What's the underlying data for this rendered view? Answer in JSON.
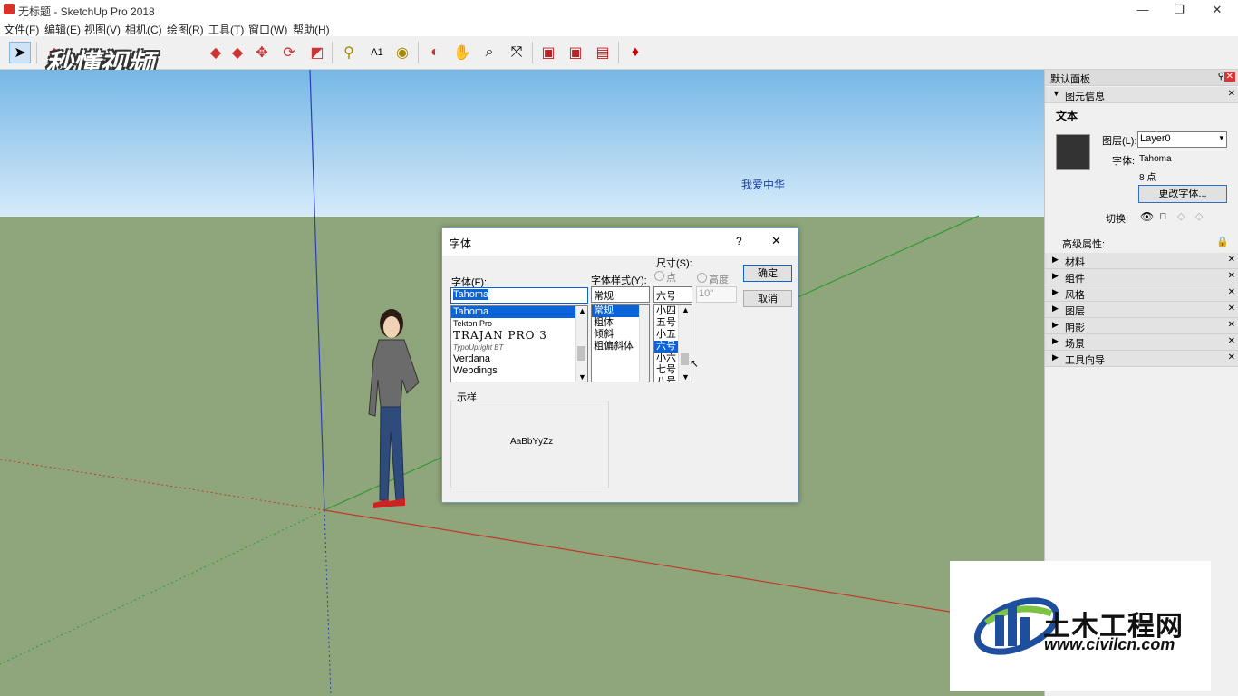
{
  "window": {
    "title": "无标题 - SketchUp Pro 2018",
    "min": "—",
    "restore": "❐",
    "close": "✕"
  },
  "menu": [
    "文件(F)",
    "编辑(E)",
    "视图(V)",
    "相机(C)",
    "绘图(R)",
    "工具(T)",
    "窗口(W)",
    "帮助(H)"
  ],
  "overlay_logo": "秒懂视频",
  "viewport": {
    "text3d": "我爱中华"
  },
  "panel": {
    "title": "默认面板",
    "entity_info": {
      "header": "图元信息",
      "kind": "文本",
      "layer_label": "图层(L):",
      "layer_value": "Layer0",
      "font_label": "字体:",
      "font_value": "Tahoma",
      "size_value": "8 点",
      "change_font_button": "更改字体...",
      "toggle_label": "切换:",
      "advanced_label": "高级属性:"
    },
    "sections": [
      "材料",
      "组件",
      "风格",
      "图层",
      "阴影",
      "场景",
      "工具向导"
    ]
  },
  "dialog": {
    "title": "字体",
    "help": "?",
    "close": "✕",
    "font_label": "字体(F):",
    "font_input": "Tahoma",
    "font_list": [
      "Tahoma",
      "Tekton Pro",
      "TRAJAN PRO 3",
      "TypoUpright BT",
      "Verdana",
      "Webdings"
    ],
    "font_selected": 0,
    "style_label": "字体样式(Y):",
    "style_input": "常规",
    "style_list": [
      "常规",
      "粗体",
      "倾斜",
      "粗偏斜体"
    ],
    "style_selected": 0,
    "size_label": "尺寸(S):",
    "radio_points": "点",
    "radio_height": "高度",
    "size_input": "六号",
    "height_input": "10\"",
    "size_list": [
      "小四",
      "五号",
      "小五",
      "六号",
      "小六",
      "七号",
      "八号"
    ],
    "size_selected": 3,
    "ok": "确定",
    "cancel": "取消",
    "sample_label": "示样",
    "sample_text": "AaBbYyZz"
  },
  "watermark": {
    "title": "土木工程网",
    "url": "www.civilcn.com"
  },
  "colors": {
    "sky_top": "#76b7e6",
    "ground": "#8fa57b",
    "selection": "#0a64d8",
    "axis_red": "#c0392b",
    "axis_green": "#2e9a2e",
    "axis_blue": "#2b3fb3"
  }
}
